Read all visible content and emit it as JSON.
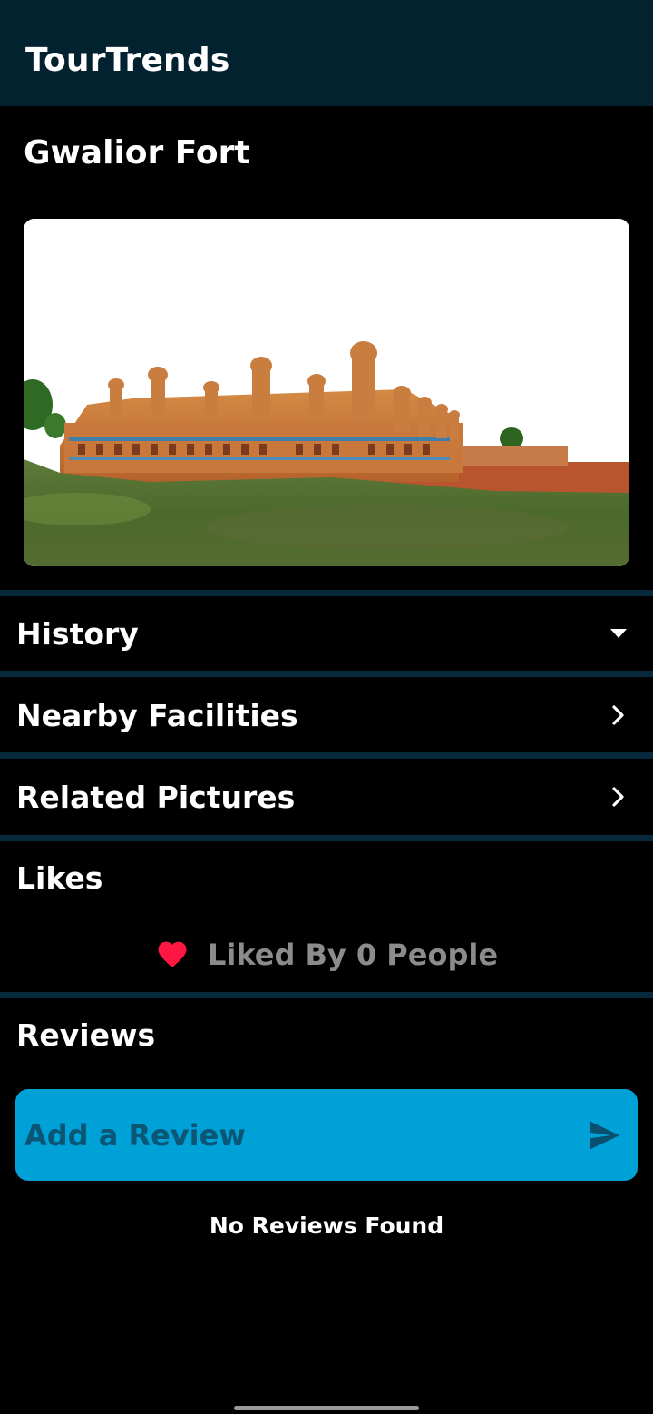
{
  "app": {
    "title": "TourTrends"
  },
  "place": {
    "title": "Gwalior Fort",
    "photo_alt": "Gwalior Fort"
  },
  "sections": {
    "history": {
      "label": "History",
      "icon": "caret-down-icon"
    },
    "nearby": {
      "label": "Nearby Facilities",
      "icon": "chevron-right-icon"
    },
    "pictures": {
      "label": "Related Pictures",
      "icon": "chevron-right-icon"
    }
  },
  "likes": {
    "title": "Likes",
    "text": "Liked By 0 People",
    "icon": "heart-icon",
    "heart_color": "#ff1744"
  },
  "reviews": {
    "title": "Reviews",
    "input_placeholder": "Add a Review",
    "input_value": "",
    "send_icon": "send-icon",
    "empty_text": "No Reviews Found"
  },
  "colors": {
    "appbar": "#032230",
    "divider": "#062a3b",
    "input_bg": "#00a1d6"
  }
}
